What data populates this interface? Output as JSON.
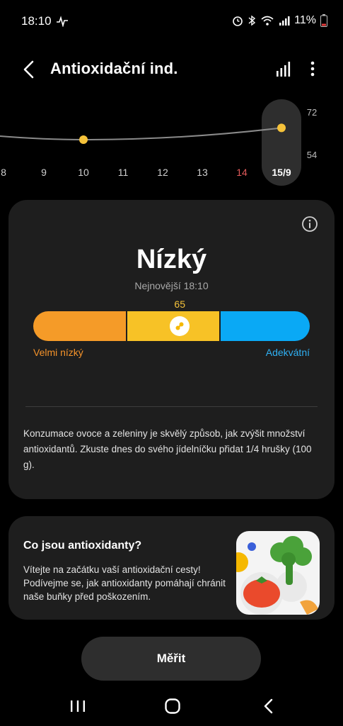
{
  "status_bar": {
    "time": "18:10",
    "battery": "11%",
    "icons": [
      "activity-icon",
      "alarm-icon",
      "bluetooth-icon",
      "wifi-icon",
      "signal-icon",
      "battery-icon"
    ]
  },
  "header": {
    "title": "Antioxidační ind.",
    "icons": [
      "back-icon",
      "bar-chart-icon",
      "more-vertical-icon"
    ]
  },
  "chart_data": {
    "type": "line",
    "x": [
      "8",
      "9",
      "10",
      "11",
      "12",
      "13",
      "14",
      "15/9"
    ],
    "highlighted_x": [
      "14"
    ],
    "selected_x": "15/9",
    "points": [
      {
        "x": "10",
        "y": 60
      },
      {
        "x": "15/9",
        "y": 65
      }
    ],
    "y_ticks": [
      72,
      54
    ],
    "colors": {
      "point": "#f5c23a",
      "line": "#8a8a8a",
      "selected_bg": "#2e2e2e",
      "highlight_label": "#e05a5a"
    }
  },
  "result": {
    "level": "Nízký",
    "latest": "Nejnovější 18:10",
    "score": "65",
    "score_fraction": 0.53,
    "label_low": "Velmi nízký",
    "label_adequate": "Adekvátní",
    "segments": [
      {
        "color": "#f59b28"
      },
      {
        "color": "#f7c226"
      },
      {
        "color": "#0aa9f5"
      }
    ],
    "advice": "Konzumace ovoce a zeleniny je skvělý způsob, jak zvýšit množství antioxidantů. Zkuste dnes do svého jídelníčku přidat 1/4 hrušky (100 g)."
  },
  "info_card": {
    "title": "Co jsou antioxidanty?",
    "text": "Vítejte na začátku vaší antioxidační cesty! Podívejme se, jak antioxidanty pomáhají chránit naše buňky před poškozením.",
    "image": "vegetables-illustration"
  },
  "measure_button": {
    "label": "Měřit"
  },
  "nav_bar": {
    "icons": [
      "recents-icon",
      "home-icon",
      "back-nav-icon"
    ]
  }
}
